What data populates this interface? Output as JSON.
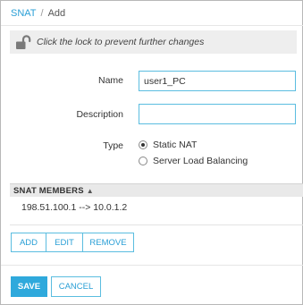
{
  "breadcrumb": {
    "parent": "SNAT",
    "separator": "/",
    "current": "Add"
  },
  "lock_bar": {
    "icon": "unlocked-padlock-icon",
    "message": "Click the lock to prevent further changes"
  },
  "form": {
    "name_label": "Name",
    "name_value": "user1_PC",
    "description_label": "Description",
    "description_value": "",
    "type_label": "Type",
    "type_options": [
      {
        "label": "Static NAT",
        "selected": true
      },
      {
        "label": "Server Load Balancing",
        "selected": false
      }
    ]
  },
  "members": {
    "header": "SNAT MEMBERS",
    "sort_icon": "sort-ascending-icon",
    "rows": [
      "198.51.100.1 --> 10.0.1.2"
    ]
  },
  "member_actions": {
    "add": "ADD",
    "edit": "EDIT",
    "remove": "REMOVE"
  },
  "footer": {
    "save": "SAVE",
    "cancel": "CANCEL"
  },
  "colors": {
    "accent": "#2fa9dc",
    "link": "#2a9fd6",
    "input_border": "#5bbde0",
    "lock_bar_bg": "#eeeeee",
    "header_bg": "#e9e9e9"
  }
}
